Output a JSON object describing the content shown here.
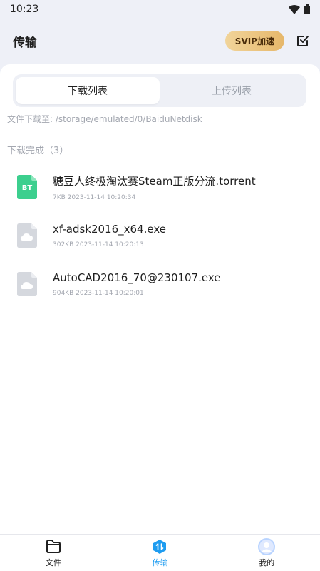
{
  "status_bar": {
    "time": "10:23"
  },
  "header": {
    "title": "传输",
    "svip_label": "SVIP加速"
  },
  "segment": {
    "tabs": [
      {
        "label": "下载列表"
      },
      {
        "label": "上传列表"
      }
    ]
  },
  "download_path": "文件下载至: /storage/emulated/0/BaiduNetdisk",
  "section_title": "下载完成（3）",
  "files": [
    {
      "name": "糖豆人终极淘汰赛Steam正版分流.torrent",
      "meta": "7KB 2023-11-14 10:20:34",
      "icon": "bt-file-icon",
      "icon_text": "BT"
    },
    {
      "name": "xf-adsk2016_x64.exe",
      "meta": "302KB 2023-11-14 10:20:13",
      "icon": "cloud-file-icon"
    },
    {
      "name": "AutoCAD2016_70@230107.exe",
      "meta": "904KB 2023-11-14 10:20:01",
      "icon": "cloud-file-icon"
    }
  ],
  "nav": [
    {
      "label": "文件",
      "icon": "folder-icon"
    },
    {
      "label": "传输",
      "icon": "transfer-icon"
    },
    {
      "label": "我的",
      "icon": "avatar-icon"
    }
  ],
  "colors": {
    "accent": "#1e9cf0",
    "svip_gold": "#e6b76a",
    "bt_green": "#3ccf8e",
    "file_gray": "#d5d8de"
  }
}
